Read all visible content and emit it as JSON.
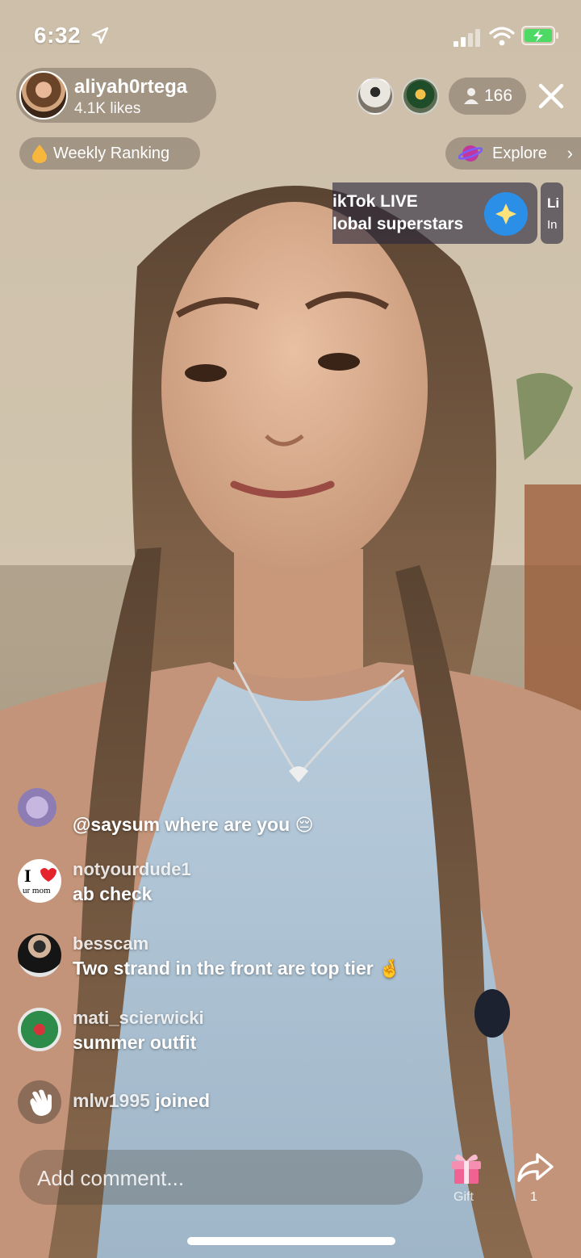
{
  "status_bar": {
    "time": "6:32",
    "icons": [
      "location-arrow-icon",
      "signal-icon",
      "wifi-icon",
      "battery-charging-icon"
    ]
  },
  "host": {
    "username": "aliyah0rtega",
    "likes": "4.1K likes"
  },
  "viewers": {
    "count": "166",
    "avatars": [
      "viewer-avatar-1",
      "viewer-avatar-2"
    ]
  },
  "ranking": {
    "label": "Weekly Ranking",
    "icon": "drop-icon"
  },
  "explore": {
    "label": "Explore",
    "chevron": "›",
    "icon": "planet-icon"
  },
  "promo": {
    "line1": "ikTok LIVE",
    "line2": "lobal superstars",
    "next_line1": "Li",
    "next_line2": "In"
  },
  "chat": [
    {
      "user": "",
      "message": "@saysum where are you",
      "emoji": "😔"
    },
    {
      "user": "notyourdude1",
      "message": "ab check",
      "emoji": ""
    },
    {
      "user": "besscam",
      "message": "Two strand in the front are top tier",
      "emoji": "🤞"
    },
    {
      "user": "mati_scierwicki",
      "message": "summer outfit",
      "emoji": ""
    },
    {
      "user": "mlw1995",
      "message": "joined",
      "emoji": ""
    }
  ],
  "avatar_text": {
    "notyourdude_line1": "I",
    "notyourdude_line2": "ur mom"
  },
  "bottom_bar": {
    "comment_placeholder": "Add comment...",
    "gift_label": "Gift",
    "share_count": "1"
  },
  "colors": {
    "battery": "#4cd964",
    "gift": "#f06292",
    "overlay": "rgba(70,60,50,0.32)"
  }
}
